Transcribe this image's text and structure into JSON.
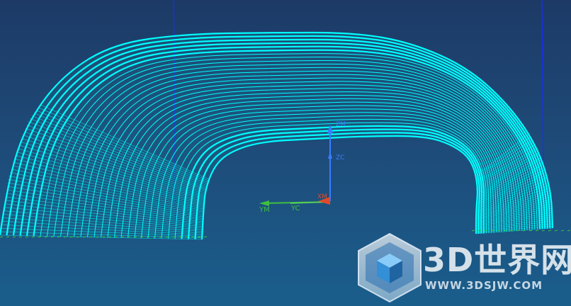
{
  "viewport": {
    "background_top": "#1d3a66",
    "background_bottom": "#1a5e8c",
    "model_color": "#00ffff",
    "model_name": "toolpath-wireframe-arch"
  },
  "csys": {
    "ym_label": "YM",
    "yc_label": "YC",
    "xm_label": "XM",
    "zm_label": "ZM",
    "zc_label": "ZC",
    "y_color": "#3fbf3f",
    "x_color": "#e04a2a",
    "z_color": "#3a7cff"
  },
  "watermark": {
    "title": "3D世界网",
    "url": "WWW.3DSJW.COM",
    "logo_icon": "cube-hexagon-icon"
  }
}
